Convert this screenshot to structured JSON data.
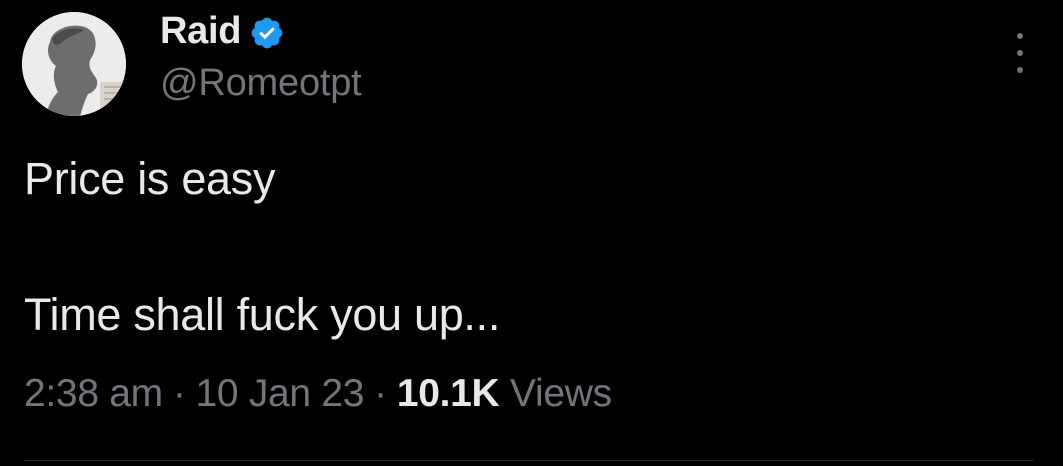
{
  "author": {
    "display_name": "Raid",
    "handle": "@Romeotpt",
    "verified": true
  },
  "tweet": {
    "lines": [
      "Price is easy",
      "",
      "Time shall fuck you up..."
    ]
  },
  "meta": {
    "time": "2:38 am",
    "separator": "·",
    "date": "10 Jan 23",
    "views_count": "10.1K",
    "views_label": "Views"
  },
  "colors": {
    "background": "#000000",
    "text_primary": "#e7e9ea",
    "text_secondary": "#71767b",
    "verified_blue": "#1d9bf0"
  },
  "icons": {
    "verified": "verified-badge-icon",
    "more": "more-options-icon"
  }
}
